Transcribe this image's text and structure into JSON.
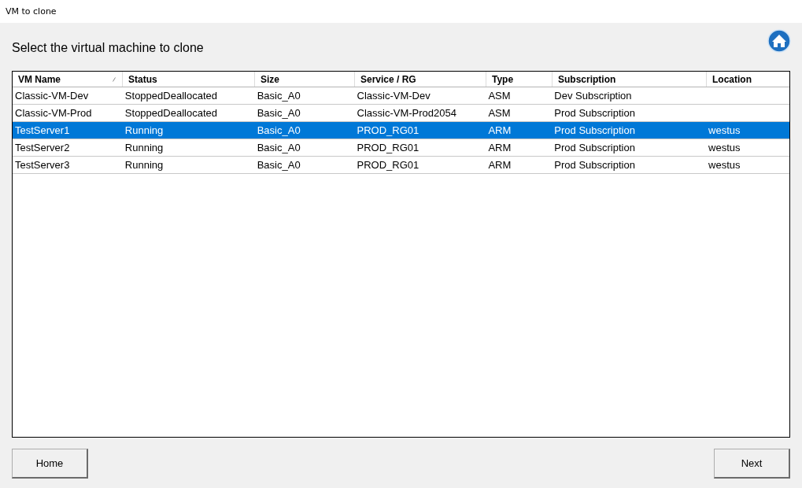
{
  "window": {
    "title": "VM to clone"
  },
  "heading": "Select the virtual machine to clone",
  "table": {
    "columns": [
      {
        "label": "VM Name",
        "sorted": true
      },
      {
        "label": "Status",
        "sorted": false
      },
      {
        "label": "Size",
        "sorted": false
      },
      {
        "label": "Service / RG",
        "sorted": false
      },
      {
        "label": "Type",
        "sorted": false
      },
      {
        "label": "Subscription",
        "sorted": false
      },
      {
        "label": "Location",
        "sorted": false
      }
    ],
    "rows": [
      {
        "selected": false,
        "cells": [
          "Classic-VM-Dev",
          "StoppedDeallocated",
          "Basic_A0",
          "Classic-VM-Dev",
          "ASM",
          "Dev Subscription",
          ""
        ]
      },
      {
        "selected": false,
        "cells": [
          "Classic-VM-Prod",
          "StoppedDeallocated",
          "Basic_A0",
          "Classic-VM-Prod2054",
          "ASM",
          "Prod Subscription",
          ""
        ]
      },
      {
        "selected": true,
        "cells": [
          "TestServer1",
          "Running",
          "Basic_A0",
          "PROD_RG01",
          "ARM",
          "Prod Subscription",
          "westus"
        ]
      },
      {
        "selected": false,
        "cells": [
          "TestServer2",
          "Running",
          "Basic_A0",
          "PROD_RG01",
          "ARM",
          "Prod Subscription",
          "westus"
        ]
      },
      {
        "selected": false,
        "cells": [
          "TestServer3",
          "Running",
          "Basic_A0",
          "PROD_RG01",
          "ARM",
          "Prod Subscription",
          "westus"
        ]
      }
    ]
  },
  "buttons": {
    "left": "Home",
    "right": "Next"
  }
}
